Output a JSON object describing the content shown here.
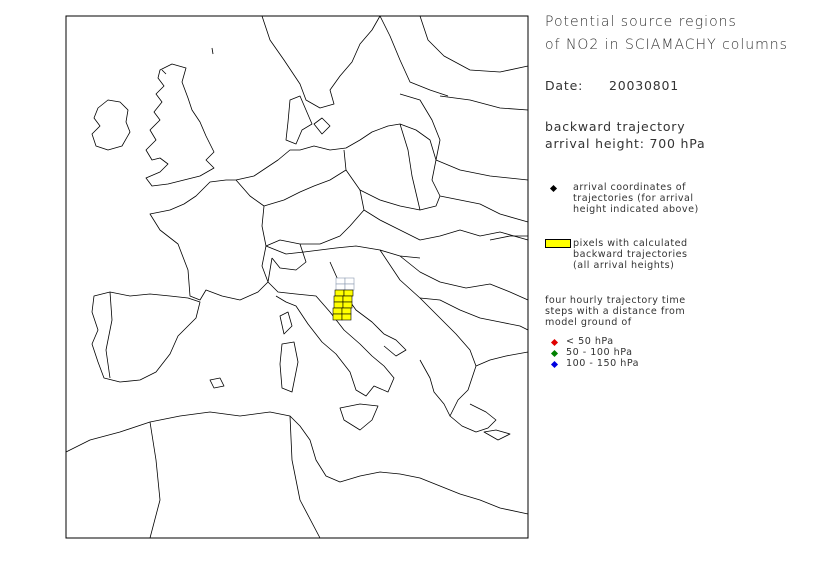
{
  "title_line1": "Potential source regions",
  "title_line2": "of NO2 in SCIAMACHY columns",
  "date_label": "Date:",
  "date_value": "20030801",
  "trajectory_type": "backward trajectory",
  "arrival_height": "arrival height: 700 hPa",
  "legend": {
    "arrival": {
      "icon": "black-diamond-icon",
      "color": "#000000",
      "lines": [
        "arrival coordinates of",
        "trajectories (for arrival",
        "height indicated above)"
      ]
    },
    "pixels": {
      "icon": "yellow-rectangle-icon",
      "color": "#ffff00",
      "lines": [
        "pixels with calculated",
        "backward trajectories",
        "(all arrival heights)"
      ]
    },
    "steps_header": [
      "four hourly trajectory time",
      "steps with a distance from",
      "model ground of"
    ],
    "steps": [
      {
        "label": "<  50 hPa",
        "color": "#e00000",
        "icon": "red-diamond-icon"
      },
      {
        "label": "50 - 100 hPa",
        "color": "#008000",
        "icon": "green-diamond-icon"
      },
      {
        "label": "100 - 150 hPa",
        "color": "#0000e0",
        "icon": "blue-diamond-icon"
      }
    ]
  },
  "colors": {
    "coastline": "#000000",
    "pixel_fill": "#ffff00",
    "pixel_grid": "#8a9ab0"
  }
}
